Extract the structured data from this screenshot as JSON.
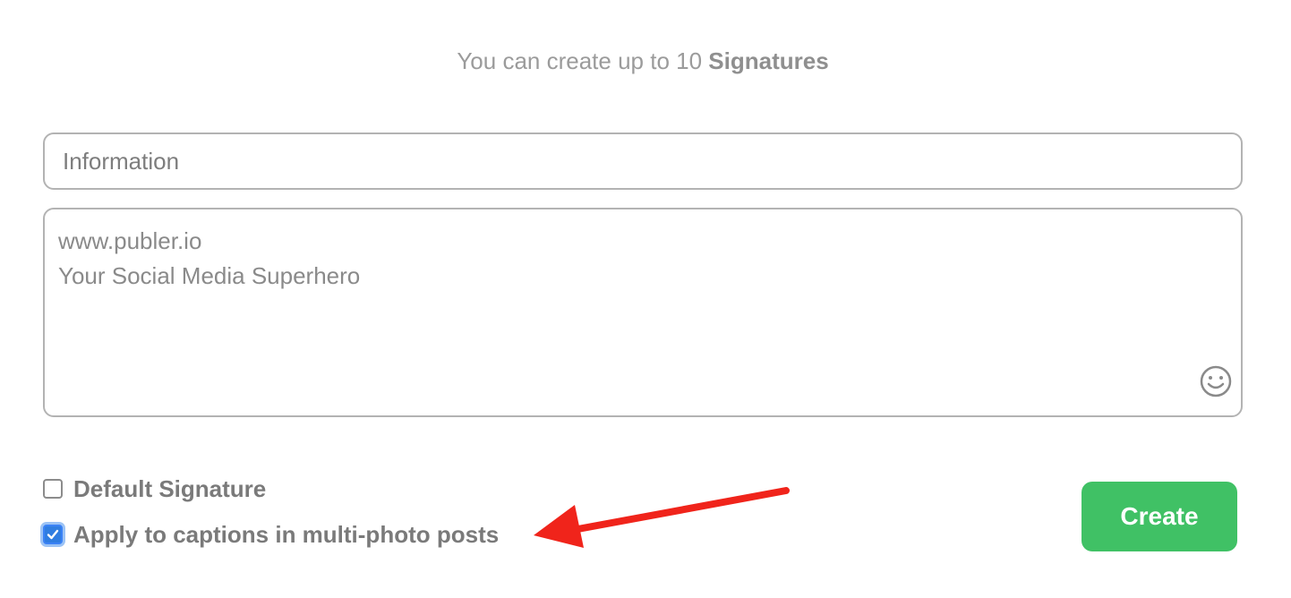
{
  "header": {
    "limit_prefix": "You can create up to 10",
    "limit_emphasis": "Signatures"
  },
  "form": {
    "name_value": "Information",
    "signature_line1": "www.publer.io",
    "signature_line2": "Your Social Media Superhero",
    "emoji_icon": "smiley-icon"
  },
  "options": {
    "default_signature_label": "Default Signature",
    "default_signature_checked": false,
    "apply_captions_label": "Apply to captions in multi-photo posts",
    "apply_captions_checked": true
  },
  "actions": {
    "create_label": "Create"
  },
  "colors": {
    "accent_green": "#40c165",
    "checkbox_blue": "#2f7de1",
    "annotation_red": "#f0241b"
  }
}
